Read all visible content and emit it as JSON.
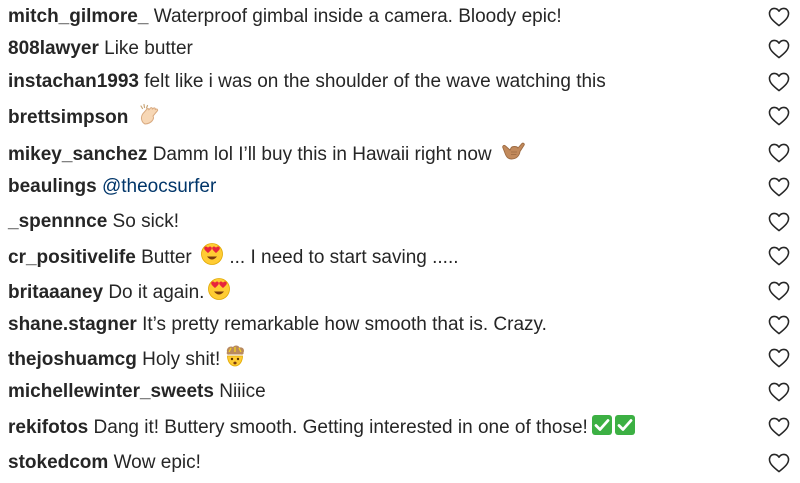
{
  "comments": [
    {
      "user": "mitch_gilmore_",
      "text": "Waterproof gimbal inside a camera. Bloody epic!"
    },
    {
      "user": "808lawyer",
      "text": "Like butter"
    },
    {
      "user": "instachan1993",
      "text": "felt like i was on the shoulder of the wave watching this"
    },
    {
      "user": "brettsimpson",
      "text": "",
      "emoji": [
        "clap-emoji"
      ]
    },
    {
      "user": "mikey_sanchez",
      "text": "Damm lol I’ll buy this in Hawaii right now",
      "emoji": [
        "shaka-emoji"
      ]
    },
    {
      "user": "beaulings",
      "mention": "@theocsurfer"
    },
    {
      "user": "_spennnce",
      "text": "So sick!"
    },
    {
      "user": "cr_positivelife",
      "text": "Butter",
      "emoji": [
        "heart-eyes-emoji"
      ],
      "text2": "... I need to start saving ....."
    },
    {
      "user": "britaaaney",
      "text": "Do it again.",
      "emoji": [
        "heart-eyes-emoji"
      ]
    },
    {
      "user": "shane.stagner",
      "text": "It’s pretty remarkable how smooth that is. Crazy."
    },
    {
      "user": "thejoshuamcg",
      "text": "Holy shit!",
      "emoji": [
        "mind-blown-emoji"
      ]
    },
    {
      "user": "michellewinter_sweets",
      "text": "Niiice"
    },
    {
      "user": "rekifotos",
      "text": "Dang it! Buttery smooth. Getting interested in one of those!",
      "emoji": [
        "check-mark-emoji",
        "check-mark-emoji"
      ]
    },
    {
      "user": "stokedcom",
      "text": "Wow epic!"
    }
  ],
  "colors": {
    "text": "#262626",
    "mention": "#003569",
    "heart_outline": "#262626"
  },
  "icons": {
    "like": "heart-outline-icon"
  }
}
